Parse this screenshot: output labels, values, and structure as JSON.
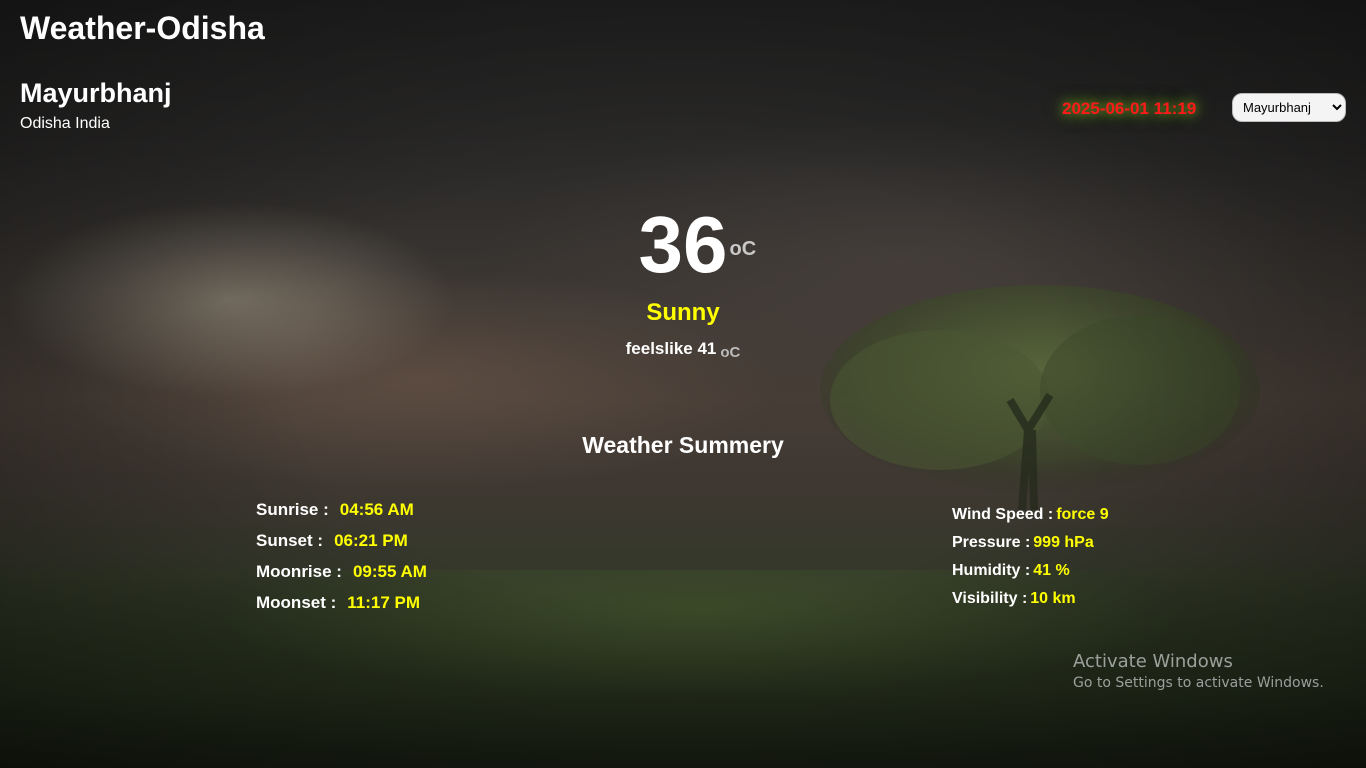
{
  "app_title": "Weather-Odisha",
  "location": {
    "city": "Mayurbhanj",
    "region": "Odisha India"
  },
  "datetime": "2025-06-01 11:19",
  "city_select": {
    "selected": "Mayurbhanj"
  },
  "current": {
    "temperature": "36",
    "unit": "oC",
    "condition": "Sunny",
    "feelslike_label": "feelslike 41",
    "feelslike_unit": "oC"
  },
  "summary_title": "Weather Summery",
  "astro": [
    {
      "label": "Sunrise :",
      "value": "04:56 AM"
    },
    {
      "label": "Sunset :",
      "value": "06:21 PM"
    },
    {
      "label": "Moonrise :",
      "value": "09:55 AM"
    },
    {
      "label": "Moonset :",
      "value": "11:17 PM"
    }
  ],
  "stats": [
    {
      "label": "Wind Speed :",
      "value": "force 9"
    },
    {
      "label": "Pressure :",
      "value": "999 hPa"
    },
    {
      "label": "Humidity :",
      "value": "41 %"
    },
    {
      "label": "Visibility :",
      "value": "10 km"
    }
  ],
  "watermark": {
    "title": "Activate Windows",
    "subtitle": "Go to Settings to activate Windows."
  },
  "colors": {
    "accent_yellow": "#ffff00",
    "datetime_red": "#ff1a1a"
  }
}
